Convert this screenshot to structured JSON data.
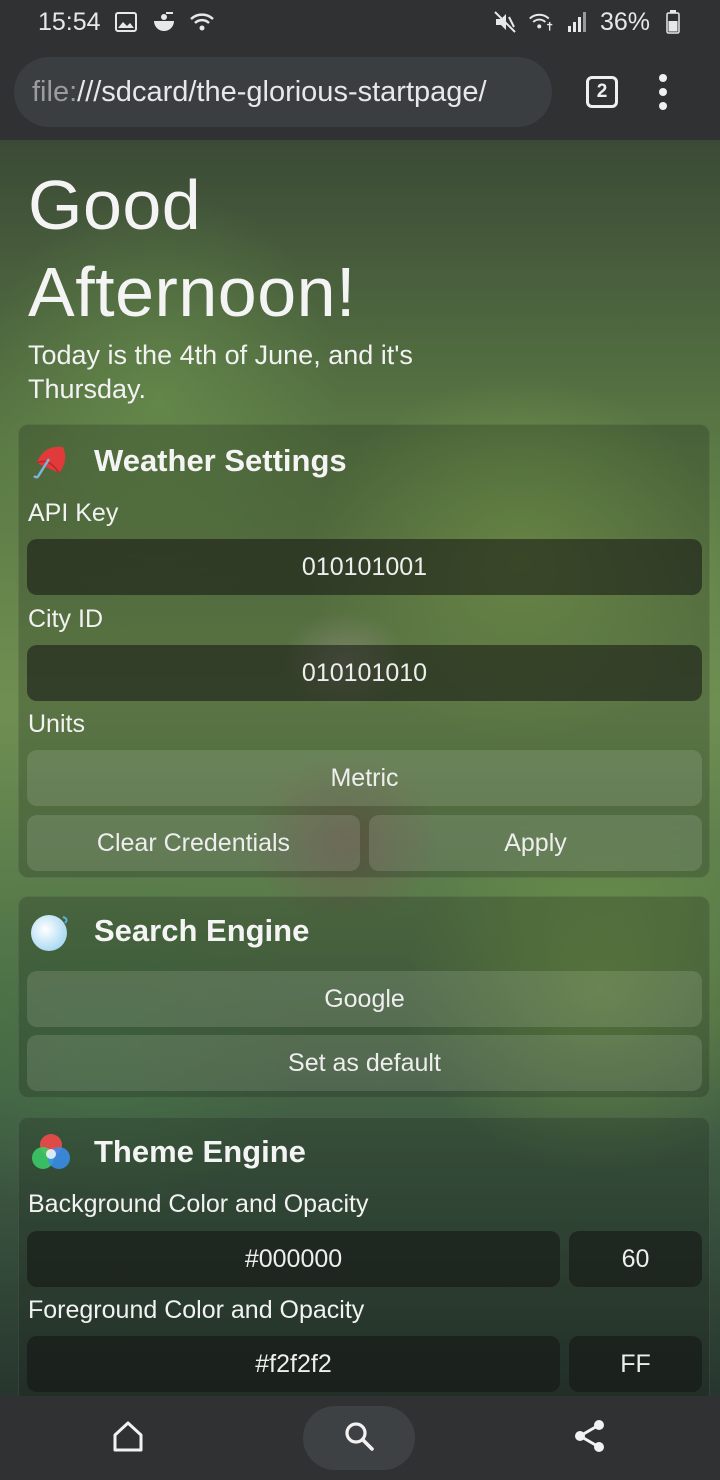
{
  "status_bar": {
    "time": "15:54",
    "left_icons": [
      "gallery-icon",
      "notification-icon",
      "wifi-icon"
    ],
    "right_icons": [
      "mute-icon",
      "wifi-calling-icon",
      "signal-icon"
    ],
    "battery": "36%"
  },
  "browser": {
    "url_scheme": "file:",
    "url_rest": "///sdcard/the-glorious-startpage/",
    "tab_count": "2"
  },
  "page": {
    "greeting_line1": "Good",
    "greeting_line2": "Afternoon!",
    "date_text": "Today is the 4th of June, and it's Thursday."
  },
  "weather": {
    "title": "Weather Settings",
    "icon": "umbrella-icon",
    "api_key_label": "API Key",
    "api_key_value": "010101001",
    "city_id_label": "City ID",
    "city_id_value": "010101010",
    "units_label": "Units",
    "units_value": "Metric",
    "clear_label": "Clear Credentials",
    "apply_label": "Apply"
  },
  "search_engine": {
    "title": "Search Engine",
    "icon": "globe-icon",
    "selected": "Google",
    "set_default_label": "Set as default"
  },
  "theme_engine": {
    "title": "Theme Engine",
    "icon": "color-circles-icon",
    "bg_label": "Background Color and Opacity",
    "bg_color": "#000000",
    "bg_opacity": "60",
    "fg_label": "Foreground Color and Opacity",
    "fg_color": "#f2f2f2",
    "fg_opacity": "FF"
  },
  "bottom_nav": {
    "items": [
      "home-icon",
      "search-icon",
      "share-icon"
    ]
  }
}
